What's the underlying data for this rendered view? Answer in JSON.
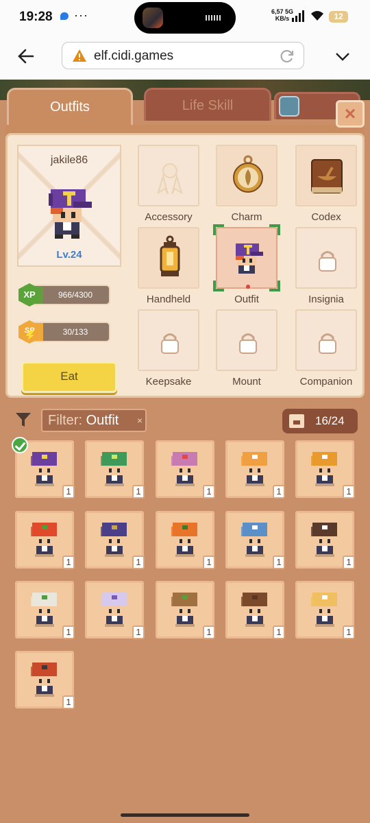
{
  "status_bar": {
    "time": "19:28",
    "dots": "···",
    "net_speed": "6,57",
    "net_unit": "KB/s",
    "net_type": "5G",
    "battery": "12"
  },
  "browser": {
    "url": "elf.cidi.games"
  },
  "tabs": {
    "outfits": "Outfits",
    "life_skill": "Life Skill"
  },
  "close_icon": "×",
  "profile": {
    "username": "jakile86",
    "level": "Lv.24",
    "xp_label": "XP",
    "xp_value": "966/4300",
    "xp_fraction": 0.2247,
    "sp_label": "SP",
    "sp_value": "30/133",
    "sp_fraction": 0.2256,
    "eat_label": "Eat"
  },
  "slots": [
    {
      "label": "Accessory",
      "icon": "ribbon-icon",
      "state": "faded"
    },
    {
      "label": "Charm",
      "icon": "compass-charm-icon",
      "state": "filled"
    },
    {
      "label": "Codex",
      "icon": "book-icon",
      "state": "filled"
    },
    {
      "label": "Handheld",
      "icon": "lantern-icon",
      "state": "filled"
    },
    {
      "label": "Outfit",
      "icon": "purple-cap-outfit-icon",
      "state": "selected"
    },
    {
      "label": "Insignia",
      "icon": "lock-icon",
      "state": "locked"
    },
    {
      "label": "Keepsake",
      "icon": "lock-icon",
      "state": "locked"
    },
    {
      "label": "Mount",
      "icon": "lock-icon",
      "state": "locked"
    },
    {
      "label": "Companion",
      "icon": "lock-icon",
      "state": "locked"
    }
  ],
  "filter": {
    "label": "Filter:",
    "value": "Outfit",
    "clear": "×"
  },
  "counter": {
    "value": "16/24"
  },
  "outfits": [
    {
      "name": "purple-cap",
      "qty": "1",
      "hat": "#6b3fa0",
      "hat2": "#f2d24a",
      "equipped": true
    },
    {
      "name": "anglerfish",
      "qty": "1",
      "hat": "#3f9a5a",
      "hat2": "#c7e86a",
      "equipped": false
    },
    {
      "name": "pink-goggles",
      "qty": "1",
      "hat": "#c77bb0",
      "hat2": "#e24646",
      "equipped": false
    },
    {
      "name": "tiger-hood",
      "qty": "1",
      "hat": "#f0a040",
      "hat2": "#ffffff",
      "equipped": false
    },
    {
      "name": "miner-helmet",
      "qty": "1",
      "hat": "#e99a2c",
      "hat2": "#ffffff",
      "equipped": false
    },
    {
      "name": "tomato",
      "qty": "1",
      "hat": "#e04a2a",
      "hat2": "#4aa03a",
      "equipped": false
    },
    {
      "name": "robot-head",
      "qty": "1",
      "hat": "#4b3f8a",
      "hat2": "#c9a34a",
      "equipped": false
    },
    {
      "name": "pumpkin",
      "qty": "1",
      "hat": "#e8742a",
      "hat2": "#3a7a2a",
      "equipped": false
    },
    {
      "name": "shark-hood",
      "qty": "1",
      "hat": "#5b8fc8",
      "hat2": "#ffffff",
      "equipped": false
    },
    {
      "name": "bun-hair",
      "qty": "1",
      "hat": "#5a3a2a",
      "hat2": "#ffffff",
      "equipped": false
    },
    {
      "name": "turban-goblin",
      "qty": "1",
      "hat": "#e9e6dc",
      "hat2": "#4aa03a",
      "equipped": false
    },
    {
      "name": "astronaut",
      "qty": "1",
      "hat": "#d7c9ee",
      "hat2": "#7a5ab8",
      "equipped": false
    },
    {
      "name": "tree-stump",
      "qty": "1",
      "hat": "#a07040",
      "hat2": "#5aa03a",
      "equipped": false
    },
    {
      "name": "cowboy-hat",
      "qty": "1",
      "hat": "#7a4a2a",
      "hat2": "#5a3520",
      "equipped": false
    },
    {
      "name": "blonde-chick",
      "qty": "1",
      "hat": "#f0c060",
      "hat2": "#ffffff",
      "equipped": false
    },
    {
      "name": "red-helmet",
      "qty": "1",
      "hat": "#c84a2a",
      "hat2": "#3a3a3a",
      "equipped": false
    }
  ]
}
